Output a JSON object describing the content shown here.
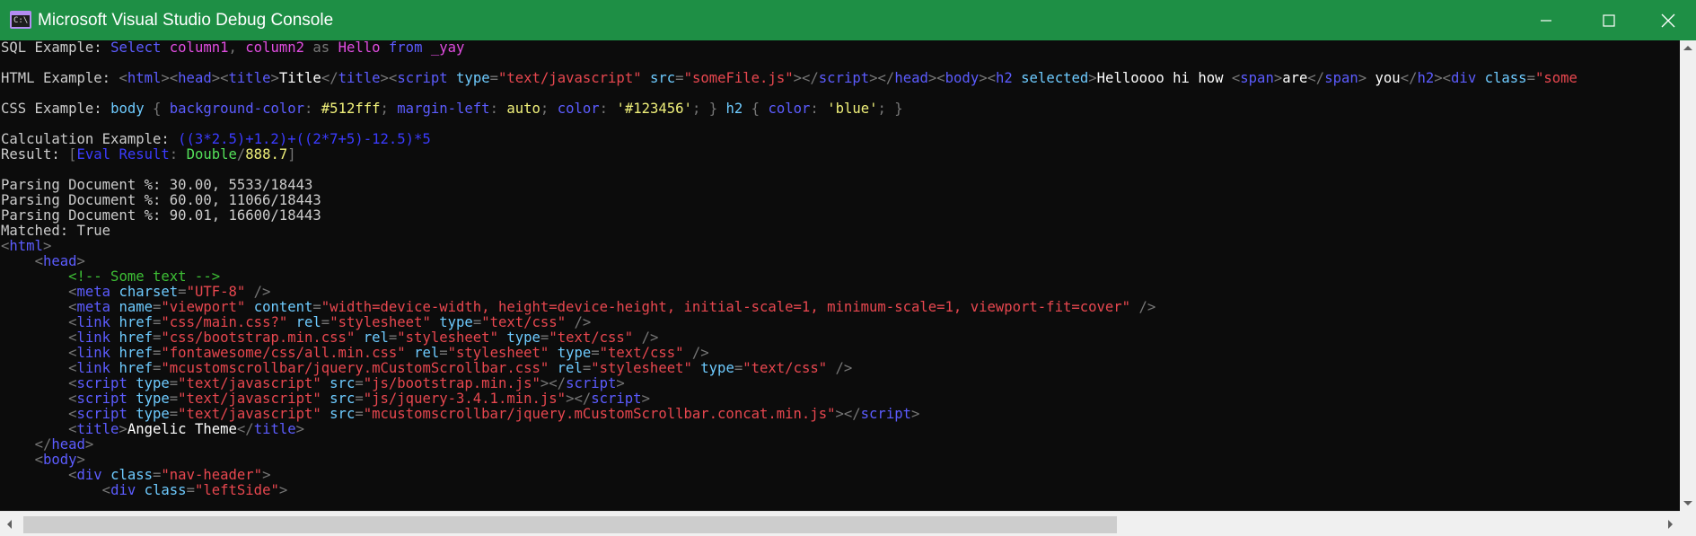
{
  "window": {
    "title": "Microsoft Visual Studio Debug Console",
    "icon_glyph": "C:\\"
  },
  "console": {
    "lines": [
      [
        [
          "w",
          "SQL Example: "
        ],
        [
          "blu",
          "Select "
        ],
        [
          "mag",
          "column1"
        ],
        [
          "gry",
          ", "
        ],
        [
          "mag",
          "column2 "
        ],
        [
          "gry",
          "as "
        ],
        [
          "mag",
          "Hello "
        ],
        [
          "blu",
          "from "
        ],
        [
          "mag",
          "_yay"
        ]
      ],
      [],
      [
        [
          "w",
          "HTML Example: "
        ],
        [
          "gry",
          "<"
        ],
        [
          "blu",
          "html"
        ],
        [
          "gry",
          "><"
        ],
        [
          "blu",
          "head"
        ],
        [
          "gry",
          "><"
        ],
        [
          "blu",
          "title"
        ],
        [
          "gry",
          ">"
        ],
        [
          "b",
          "Title"
        ],
        [
          "gry",
          "</"
        ],
        [
          "blu",
          "title"
        ],
        [
          "gry",
          "><"
        ],
        [
          "blu",
          "script "
        ],
        [
          "cyn",
          "type"
        ],
        [
          "gry",
          "="
        ],
        [
          "red",
          "\"text/javascript\" "
        ],
        [
          "cyn",
          "src"
        ],
        [
          "gry",
          "="
        ],
        [
          "red",
          "\"someFile.js\""
        ],
        [
          "gry",
          "></"
        ],
        [
          "blu",
          "script"
        ],
        [
          "gry",
          "></"
        ],
        [
          "blu",
          "head"
        ],
        [
          "gry",
          "><"
        ],
        [
          "blu",
          "body"
        ],
        [
          "gry",
          "><"
        ],
        [
          "blu",
          "h2 "
        ],
        [
          "cyn",
          "selected"
        ],
        [
          "gry",
          ">"
        ],
        [
          "b",
          "Helloooo hi how "
        ],
        [
          "gry",
          "<"
        ],
        [
          "blu",
          "span"
        ],
        [
          "gry",
          ">"
        ],
        [
          "b",
          "are"
        ],
        [
          "gry",
          "</"
        ],
        [
          "blu",
          "span"
        ],
        [
          "gry",
          "> "
        ],
        [
          "b",
          "you"
        ],
        [
          "gry",
          "</"
        ],
        [
          "blu",
          "h2"
        ],
        [
          "gry",
          "><"
        ],
        [
          "blu",
          "div "
        ],
        [
          "cyn",
          "class"
        ],
        [
          "gry",
          "="
        ],
        [
          "red",
          "\"some"
        ]
      ],
      [],
      [
        [
          "w",
          "CSS Example: "
        ],
        [
          "cyn",
          "body "
        ],
        [
          "gry",
          "{ "
        ],
        [
          "blu",
          "background-color"
        ],
        [
          "gry",
          ": "
        ],
        [
          "yel",
          "#512fff"
        ],
        [
          "gry",
          "; "
        ],
        [
          "blu",
          "margin-left"
        ],
        [
          "gry",
          ": "
        ],
        [
          "yel",
          "auto"
        ],
        [
          "gry",
          "; "
        ],
        [
          "blu",
          "color"
        ],
        [
          "gry",
          ": "
        ],
        [
          "yel",
          "'#123456'"
        ],
        [
          "gry",
          "; } "
        ],
        [
          "cyn",
          "h2 "
        ],
        [
          "gry",
          "{ "
        ],
        [
          "blu",
          "color"
        ],
        [
          "gry",
          ": "
        ],
        [
          "yel",
          "'blue'"
        ],
        [
          "gry",
          "; }"
        ]
      ],
      [],
      [
        [
          "w",
          "Calculation Example: "
        ],
        [
          "dbl",
          "((3*2.5)+1.2)+((2*7+5)-12.5)*5"
        ]
      ],
      [
        [
          "w",
          "Result: "
        ],
        [
          "gry",
          "["
        ],
        [
          "dbl",
          "Eval Result"
        ],
        [
          "gry",
          ": "
        ],
        [
          "lgr",
          "Double"
        ],
        [
          "gry",
          "/"
        ],
        [
          "yel",
          "888.7"
        ],
        [
          "gry",
          "]"
        ]
      ],
      [],
      [
        [
          "w",
          "Parsing Document %: 30.00, 5533/18443"
        ]
      ],
      [
        [
          "w",
          "Parsing Document %: 60.00, 11066/18443"
        ]
      ],
      [
        [
          "w",
          "Parsing Document %: 90.01, 16600/18443"
        ]
      ],
      [
        [
          "w",
          "Matched: True"
        ]
      ],
      [
        [
          "gry",
          "<"
        ],
        [
          "blu",
          "html"
        ],
        [
          "gry",
          ">"
        ]
      ],
      [
        [
          "w",
          "    "
        ],
        [
          "gry",
          "<"
        ],
        [
          "blu",
          "head"
        ],
        [
          "gry",
          ">"
        ]
      ],
      [
        [
          "w",
          "        "
        ],
        [
          "grn",
          "<!-- Some text -->"
        ]
      ],
      [
        [
          "w",
          "        "
        ],
        [
          "gry",
          "<"
        ],
        [
          "blu",
          "meta "
        ],
        [
          "cyn",
          "charset"
        ],
        [
          "gry",
          "="
        ],
        [
          "red",
          "\"UTF-8\" "
        ],
        [
          "gry",
          "/>"
        ]
      ],
      [
        [
          "w",
          "        "
        ],
        [
          "gry",
          "<"
        ],
        [
          "blu",
          "meta "
        ],
        [
          "cyn",
          "name"
        ],
        [
          "gry",
          "="
        ],
        [
          "red",
          "\"viewport\" "
        ],
        [
          "cyn",
          "content"
        ],
        [
          "gry",
          "="
        ],
        [
          "red",
          "\"width=device-width, height=device-height, initial-scale=1, minimum-scale=1, viewport-fit=cover\" "
        ],
        [
          "gry",
          "/>"
        ]
      ],
      [
        [
          "w",
          "        "
        ],
        [
          "gry",
          "<"
        ],
        [
          "blu",
          "link "
        ],
        [
          "cyn",
          "href"
        ],
        [
          "gry",
          "="
        ],
        [
          "red",
          "\"css/main.css?\" "
        ],
        [
          "cyn",
          "rel"
        ],
        [
          "gry",
          "="
        ],
        [
          "red",
          "\"stylesheet\" "
        ],
        [
          "cyn",
          "type"
        ],
        [
          "gry",
          "="
        ],
        [
          "red",
          "\"text/css\" "
        ],
        [
          "gry",
          "/>"
        ]
      ],
      [
        [
          "w",
          "        "
        ],
        [
          "gry",
          "<"
        ],
        [
          "blu",
          "link "
        ],
        [
          "cyn",
          "href"
        ],
        [
          "gry",
          "="
        ],
        [
          "red",
          "\"css/bootstrap.min.css\" "
        ],
        [
          "cyn",
          "rel"
        ],
        [
          "gry",
          "="
        ],
        [
          "red",
          "\"stylesheet\" "
        ],
        [
          "cyn",
          "type"
        ],
        [
          "gry",
          "="
        ],
        [
          "red",
          "\"text/css\" "
        ],
        [
          "gry",
          "/>"
        ]
      ],
      [
        [
          "w",
          "        "
        ],
        [
          "gry",
          "<"
        ],
        [
          "blu",
          "link "
        ],
        [
          "cyn",
          "href"
        ],
        [
          "gry",
          "="
        ],
        [
          "red",
          "\"fontawesome/css/all.min.css\" "
        ],
        [
          "cyn",
          "rel"
        ],
        [
          "gry",
          "="
        ],
        [
          "red",
          "\"stylesheet\" "
        ],
        [
          "cyn",
          "type"
        ],
        [
          "gry",
          "="
        ],
        [
          "red",
          "\"text/css\" "
        ],
        [
          "gry",
          "/>"
        ]
      ],
      [
        [
          "w",
          "        "
        ],
        [
          "gry",
          "<"
        ],
        [
          "blu",
          "link "
        ],
        [
          "cyn",
          "href"
        ],
        [
          "gry",
          "="
        ],
        [
          "red",
          "\"mcustomscrollbar/jquery.mCustomScrollbar.css\" "
        ],
        [
          "cyn",
          "rel"
        ],
        [
          "gry",
          "="
        ],
        [
          "red",
          "\"stylesheet\" "
        ],
        [
          "cyn",
          "type"
        ],
        [
          "gry",
          "="
        ],
        [
          "red",
          "\"text/css\" "
        ],
        [
          "gry",
          "/>"
        ]
      ],
      [
        [
          "w",
          "        "
        ],
        [
          "gry",
          "<"
        ],
        [
          "blu",
          "script "
        ],
        [
          "cyn",
          "type"
        ],
        [
          "gry",
          "="
        ],
        [
          "red",
          "\"text/javascript\" "
        ],
        [
          "cyn",
          "src"
        ],
        [
          "gry",
          "="
        ],
        [
          "red",
          "\"js/bootstrap.min.js\""
        ],
        [
          "gry",
          "></"
        ],
        [
          "blu",
          "script"
        ],
        [
          "gry",
          ">"
        ]
      ],
      [
        [
          "w",
          "        "
        ],
        [
          "gry",
          "<"
        ],
        [
          "blu",
          "script "
        ],
        [
          "cyn",
          "type"
        ],
        [
          "gry",
          "="
        ],
        [
          "red",
          "\"text/javascript\" "
        ],
        [
          "cyn",
          "src"
        ],
        [
          "gry",
          "="
        ],
        [
          "red",
          "\"js/jquery-3.4.1.min.js\""
        ],
        [
          "gry",
          "></"
        ],
        [
          "blu",
          "script"
        ],
        [
          "gry",
          ">"
        ]
      ],
      [
        [
          "w",
          "        "
        ],
        [
          "gry",
          "<"
        ],
        [
          "blu",
          "script "
        ],
        [
          "cyn",
          "type"
        ],
        [
          "gry",
          "="
        ],
        [
          "red",
          "\"text/javascript\" "
        ],
        [
          "cyn",
          "src"
        ],
        [
          "gry",
          "="
        ],
        [
          "red",
          "\"mcustomscrollbar/jquery.mCustomScrollbar.concat.min.js\""
        ],
        [
          "gry",
          "></"
        ],
        [
          "blu",
          "script"
        ],
        [
          "gry",
          ">"
        ]
      ],
      [
        [
          "w",
          "        "
        ],
        [
          "gry",
          "<"
        ],
        [
          "blu",
          "title"
        ],
        [
          "gry",
          ">"
        ],
        [
          "b",
          "Angelic Theme"
        ],
        [
          "gry",
          "</"
        ],
        [
          "blu",
          "title"
        ],
        [
          "gry",
          ">"
        ]
      ],
      [
        [
          "w",
          "    "
        ],
        [
          "gry",
          "</"
        ],
        [
          "blu",
          "head"
        ],
        [
          "gry",
          ">"
        ]
      ],
      [
        [
          "w",
          "    "
        ],
        [
          "gry",
          "<"
        ],
        [
          "blu",
          "body"
        ],
        [
          "gry",
          ">"
        ]
      ],
      [
        [
          "w",
          "        "
        ],
        [
          "gry",
          "<"
        ],
        [
          "blu",
          "div "
        ],
        [
          "cyn",
          "class"
        ],
        [
          "gry",
          "="
        ],
        [
          "red",
          "\"nav-header\""
        ],
        [
          "gry",
          ">"
        ]
      ],
      [
        [
          "w",
          "            "
        ],
        [
          "gry",
          "<"
        ],
        [
          "blu",
          "div "
        ],
        [
          "cyn",
          "class"
        ],
        [
          "gry",
          "="
        ],
        [
          "red",
          "\"leftSide\""
        ],
        [
          "gry",
          ">"
        ]
      ]
    ]
  }
}
